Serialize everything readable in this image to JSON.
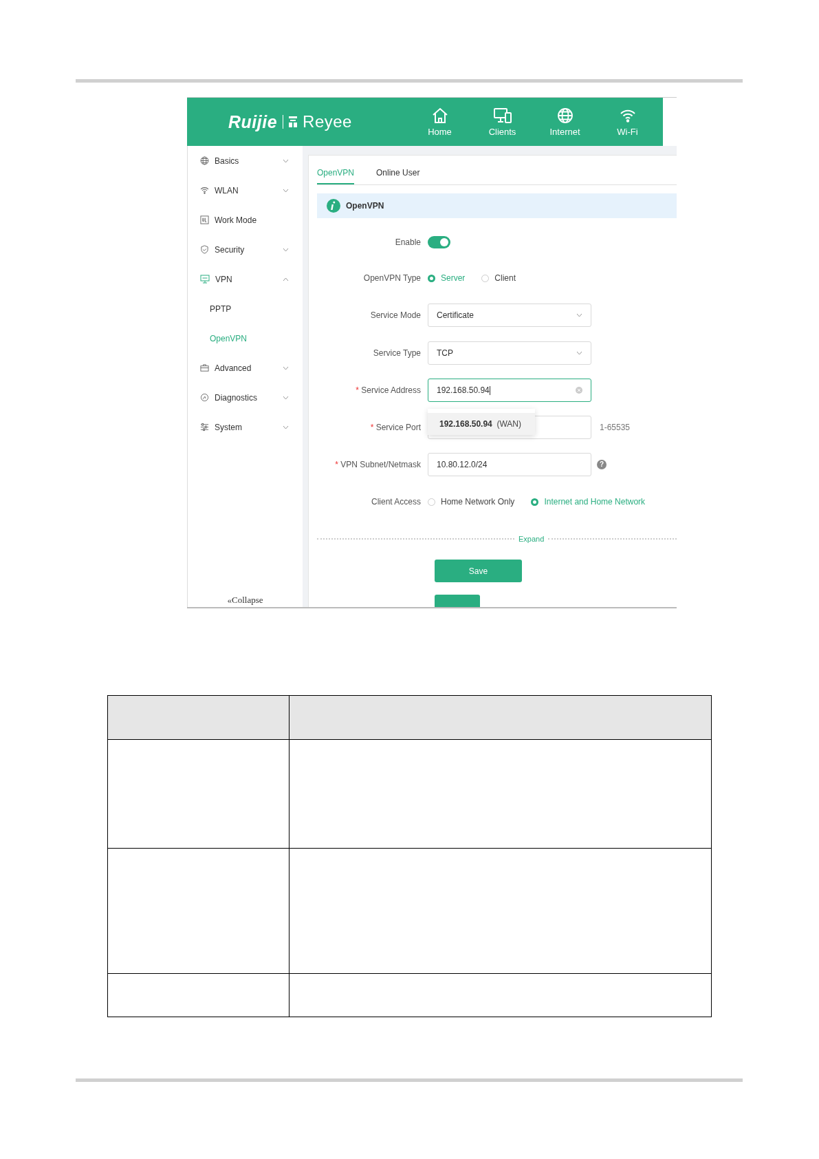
{
  "header": {
    "brand": "Ruijie",
    "sub_brand": "Reyee",
    "nav": [
      {
        "label": "Home"
      },
      {
        "label": "Clients"
      },
      {
        "label": "Internet"
      },
      {
        "label": "Wi-Fi"
      }
    ]
  },
  "sidebar": {
    "items": [
      {
        "label": "Basics",
        "expanded": false
      },
      {
        "label": "WLAN",
        "expanded": false
      },
      {
        "label": "Work Mode"
      },
      {
        "label": "Security",
        "expanded": false
      },
      {
        "label": "VPN",
        "expanded": true,
        "children": [
          {
            "label": "PPTP",
            "selected": false
          },
          {
            "label": "OpenVPN",
            "selected": true
          }
        ]
      },
      {
        "label": "Advanced",
        "expanded": false
      },
      {
        "label": "Diagnostics",
        "expanded": false
      },
      {
        "label": "System",
        "expanded": false
      }
    ],
    "collapse": "«Collapse"
  },
  "tabs": [
    {
      "label": "OpenVPN",
      "selected": true
    },
    {
      "label": "Online User",
      "selected": false
    }
  ],
  "banner": "OpenVPN",
  "form": [
    {
      "kind": "switch",
      "label": "Enable",
      "on": true
    },
    {
      "kind": "radio",
      "label": "OpenVPN Type",
      "options": [
        {
          "label": "Server",
          "selected": true
        },
        {
          "label": "Client",
          "selected": false
        }
      ]
    },
    {
      "kind": "select",
      "label": "Service Mode",
      "value": "Certificate"
    },
    {
      "kind": "select",
      "label": "Service Type",
      "value": "TCP"
    },
    {
      "kind": "input",
      "label": "Service Address",
      "mark": "*",
      "value": "192.168.50.94",
      "focused": true,
      "suggestion": {
        "address": "192.168.50.94",
        "note": "(WAN)"
      }
    },
    {
      "kind": "input",
      "label": "Service Port",
      "mark": "*",
      "focused": false,
      "hint": "1-65535"
    },
    {
      "kind": "input",
      "label": "VPN Subnet/Netmask",
      "mark": "*",
      "value": "10.80.12.0/24",
      "focused": false,
      "help": "?"
    },
    {
      "kind": "radio",
      "label": "Client Access",
      "options": [
        {
          "label": "Home Network Only",
          "selected": false
        },
        {
          "label": "Internet and Home Network",
          "selected": true
        }
      ]
    }
  ],
  "expand": "Expand",
  "save": "Save"
}
